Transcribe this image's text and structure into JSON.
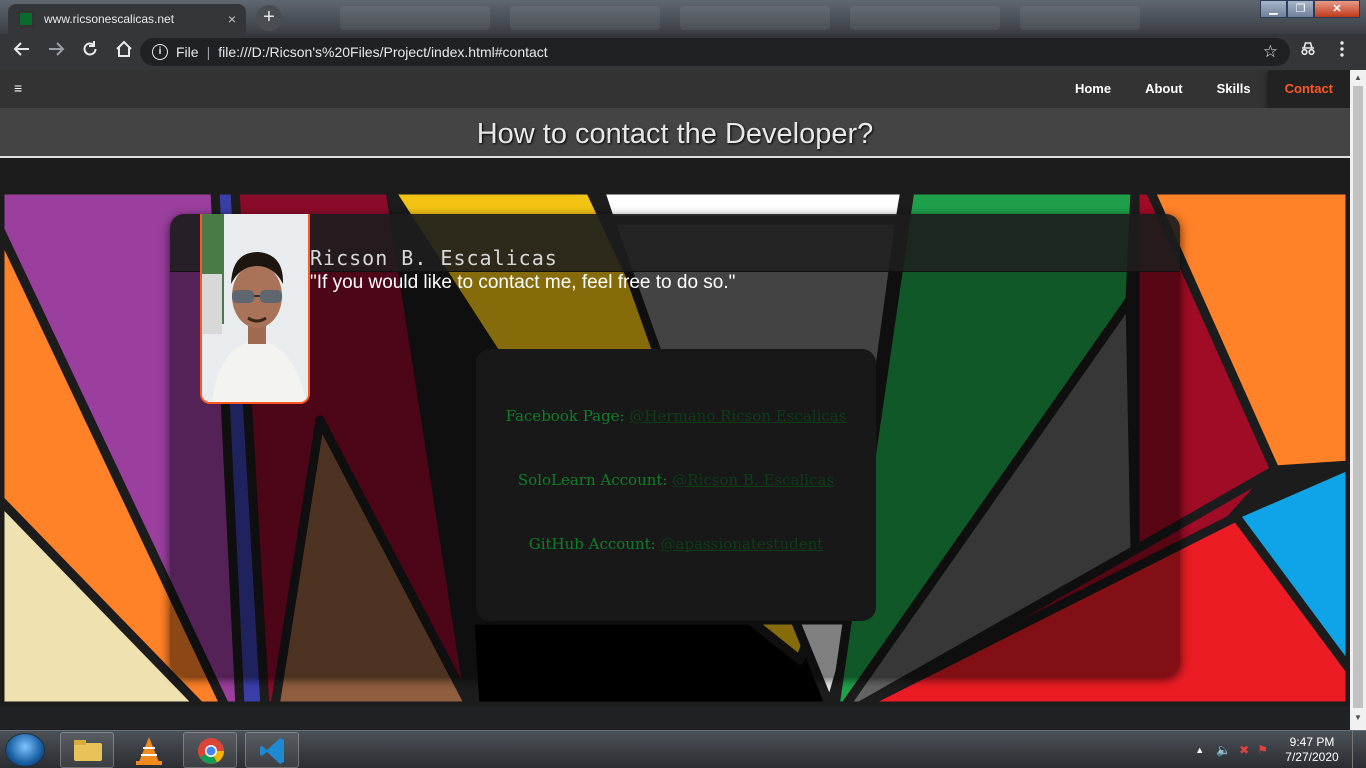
{
  "browser": {
    "tab_title": "www.ricsonescalicas.net",
    "tab_close": "×",
    "new_tab": "+",
    "address_prefix": "File",
    "address_url": "file:///D:/Ricson's%20Files/Project/index.html#contact"
  },
  "nav": {
    "menu_icon": "≡",
    "links": [
      "Home",
      "About",
      "Skills",
      "Contact"
    ],
    "active": "Contact"
  },
  "header": {
    "title": "How to contact the Developer?"
  },
  "profile": {
    "name": "Ricson B. Escalicas",
    "quote": "\"If you would like to contact me, feel free to do so.\""
  },
  "contacts": [
    {
      "label": "Facebook Page:",
      "value": "@Hermano Ricson Escalicas"
    },
    {
      "label": "SoloLearn Account:",
      "value": "@Ricson B. Escalicas"
    },
    {
      "label": "GitHub Account:",
      "value": "@apassionatestudent"
    }
  ],
  "taskbar": {
    "time": "9:47 PM",
    "date": "7/27/2020"
  },
  "colors": {
    "accent": "#ff5722",
    "contact_label": "#0f7d2a"
  }
}
